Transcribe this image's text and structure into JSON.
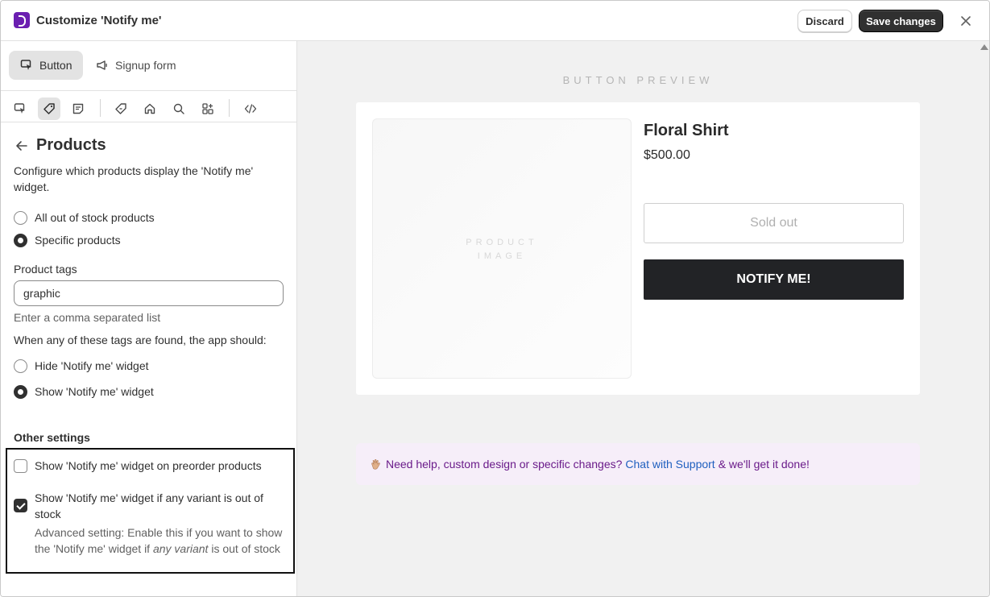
{
  "window": {
    "title": "Customize 'Notify me'",
    "discard_label": "Discard",
    "save_label": "Save changes"
  },
  "tabs": [
    {
      "label": "Button",
      "icon": "cursor-click-icon",
      "active": true
    },
    {
      "label": "Signup form",
      "icon": "megaphone-icon",
      "active": false
    }
  ],
  "toolbar": {
    "icons": [
      "cursor-click-icon",
      "tag-icon",
      "note-icon",
      "discount-tag-icon",
      "home-icon",
      "search-icon",
      "apps-icon",
      "code-icon"
    ],
    "active_index": 1
  },
  "products": {
    "heading": "Products",
    "description": "Configure which products display the 'Notify me' widget.",
    "scope_options": [
      {
        "label": "All out of stock products",
        "checked": false
      },
      {
        "label": "Specific products",
        "checked": true
      }
    ],
    "tags_label": "Product tags",
    "tags_value": "graphic",
    "tags_help": "Enter a comma separated list",
    "action_question": "When any of these tags are found, the app should:",
    "action_options": [
      {
        "label": "Hide 'Notify me' widget",
        "checked": false
      },
      {
        "label": "Show 'Notify me' widget",
        "checked": true
      }
    ]
  },
  "other_settings": {
    "title": "Other settings",
    "preorder_label": "Show 'Notify me' widget on preorder products",
    "preorder_checked": false,
    "variant_label": "Show 'Notify me' widget if any variant is out of stock",
    "variant_checked": true,
    "advanced_prefix": "Advanced setting: Enable this if you want to show the 'Notify me' widget if ",
    "advanced_em": "any variant",
    "advanced_suffix": " is out of stock"
  },
  "preview": {
    "label": "BUTTON PREVIEW",
    "image_placeholder_line1": "PRODUCT",
    "image_placeholder_line2": "IMAGE",
    "product_name": "Floral Shirt",
    "price": "$500.00",
    "sold_out_label": "Sold out",
    "notify_label": "NOTIFY ME!"
  },
  "help": {
    "prefix": "Need help, custom design or specific changes?",
    "link": "Chat with Support",
    "suffix": "& we'll get it done!"
  },
  "colors": {
    "brand": "#6b1fb1",
    "primary_button": "#303030",
    "notify_button": "#222326",
    "help_bg": "#f6eef9",
    "help_text": "#6a1b8a",
    "link": "#1f5fbf"
  }
}
